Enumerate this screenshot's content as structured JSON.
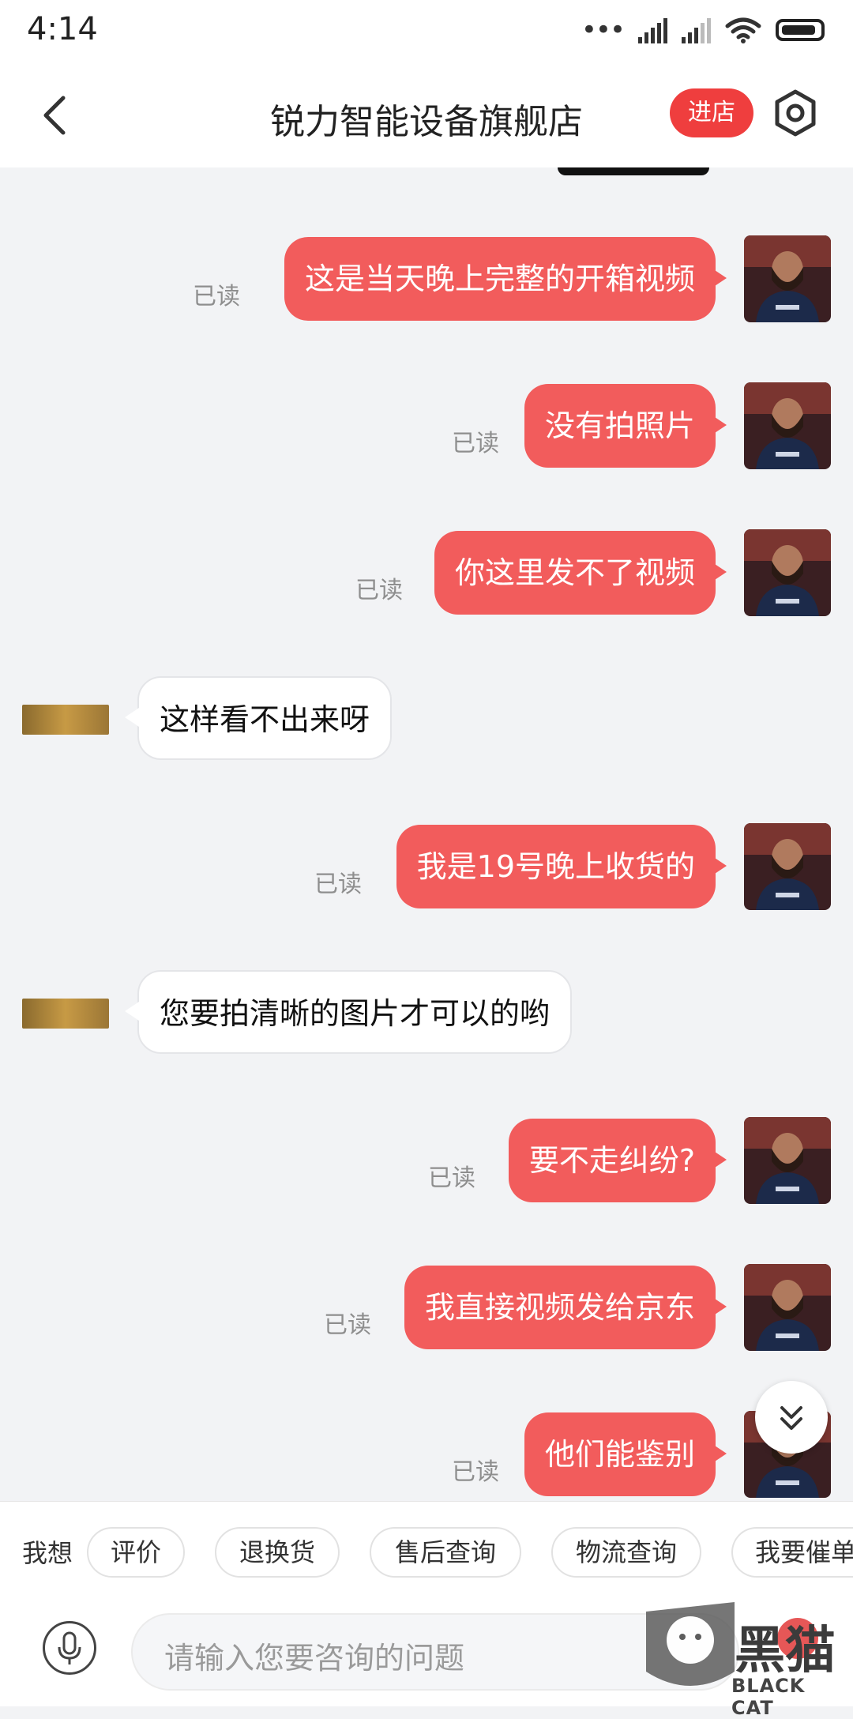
{
  "status": {
    "time": "4:14"
  },
  "header": {
    "title": "锐力智能设备旗舰店",
    "enter_shop": "进店"
  },
  "chat": {
    "messages": [
      {
        "dir": "out",
        "text": "这是当天晚上完整的开箱视频",
        "read": "已读"
      },
      {
        "dir": "out",
        "text": "没有拍照片",
        "read": "已读"
      },
      {
        "dir": "out",
        "text": "你这里发不了视频",
        "read": "已读"
      },
      {
        "dir": "in",
        "text": "这样看不出来呀"
      },
      {
        "dir": "out",
        "text": "我是19号晚上收货的",
        "read": "已读"
      },
      {
        "dir": "in",
        "text": "您要拍清晰的图片才可以的哟"
      },
      {
        "dir": "out",
        "text": "要不走纠纷?",
        "read": "已读"
      },
      {
        "dir": "out",
        "text": "我直接视频发给京东",
        "read": "已读"
      },
      {
        "dir": "out",
        "text": "他们能鉴别",
        "read": "已读"
      }
    ]
  },
  "quick": {
    "label": "我想",
    "chips": [
      "评价",
      "退换货",
      "售后查询",
      "物流查询",
      "我要催单"
    ]
  },
  "input": {
    "placeholder": "请输入您要咨询的问题"
  },
  "watermark": {
    "brand": "黑猫",
    "sub": "BLACK CAT"
  },
  "colors": {
    "accent": "#f25c5c",
    "enter_button": "#ef3e3e"
  },
  "icons": [
    "back-arrow-icon",
    "settings-hexagon-icon",
    "chevron-double-down-icon",
    "microphone-icon"
  ]
}
